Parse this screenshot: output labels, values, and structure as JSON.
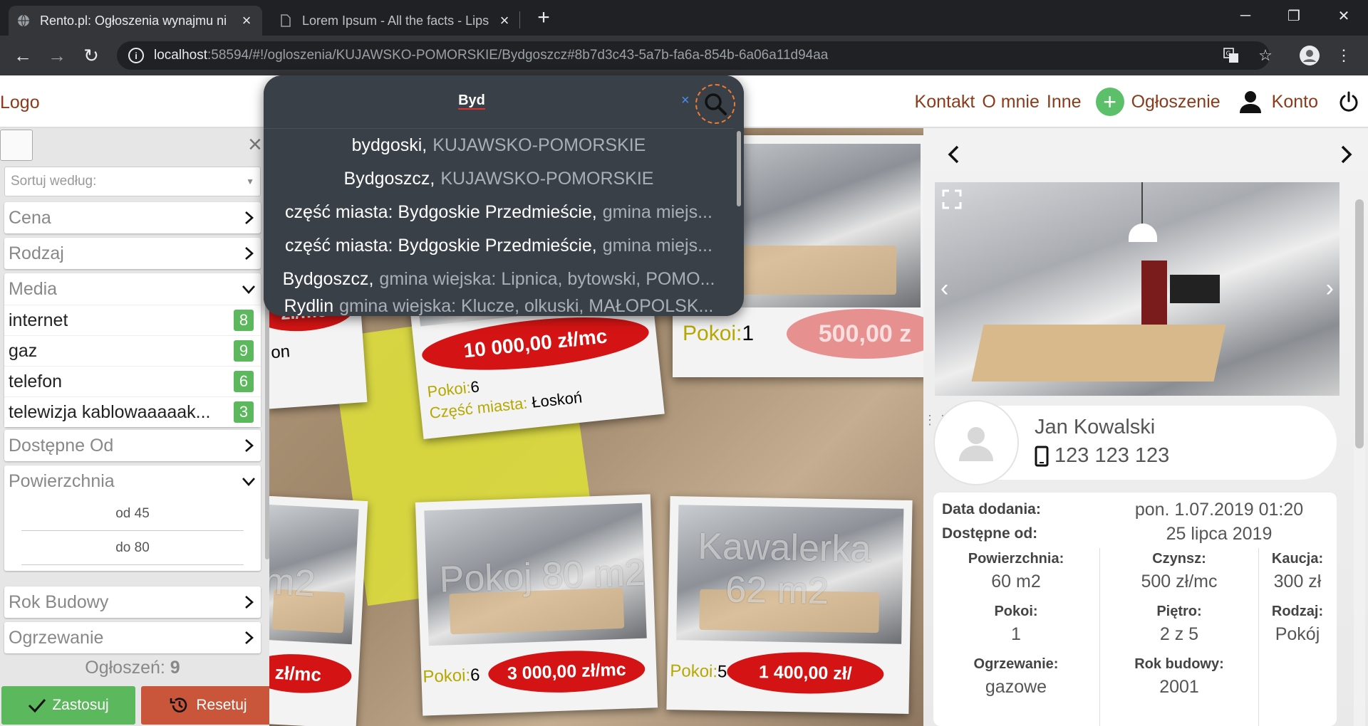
{
  "browser": {
    "tabs": [
      {
        "title": "Rento.pl: Ogłoszenia wynajmu ni",
        "active": true
      },
      {
        "title": "Lorem Ipsum - All the facts - Lips",
        "active": false
      }
    ],
    "url_host": "localhost",
    "url_rest": ":58594/#!/ogloszenia/KUJAWSKO-POMORSKIE/Bydgoszcz#8b7d3c43-5a7b-fa6a-854b-6a06a11d94aa"
  },
  "header": {
    "logo": "Logo",
    "nav": {
      "kontakt": "Kontakt",
      "omnie": "O mnie",
      "inne": "Inne",
      "ogloszenie": "Ogłoszenie",
      "konto": "Konto"
    }
  },
  "search": {
    "query": "Byd",
    "clear": "×",
    "suggestions": [
      {
        "main": "bydgoski,",
        "muted": "KUJAWSKO-POMORSKIE"
      },
      {
        "main": "Bydgoszcz,",
        "muted": "KUJAWSKO-POMORSKIE"
      },
      {
        "main": "część miasta: Bydgoskie Przedmieście,",
        "muted": "gmina miejs..."
      },
      {
        "main": "część miasta: Bydgoskie Przedmieście,",
        "muted": "gmina miejs..."
      },
      {
        "main": "Bydgoszcz,",
        "muted": "gmina wiejska: Lipnica, bytowski, POMO..."
      },
      {
        "main": "Rydlin",
        "muted": "gmina wiejska: Klucze, olkuski, MAŁOPOLSK..."
      }
    ]
  },
  "sidebar": {
    "sort_placeholder": "Sortuj według:",
    "filters": {
      "cena": "Cena",
      "rodzaj": "Rodzaj",
      "media": "Media",
      "dostepne": "Dostępne Od",
      "powierzchnia": "Powierzchnia",
      "rok": "Rok Budowy",
      "ogrzewanie": "Ogrzewanie"
    },
    "media_items": [
      {
        "label": "internet",
        "count": "8"
      },
      {
        "label": "gaz",
        "count": "9"
      },
      {
        "label": "telefon",
        "count": "6"
      },
      {
        "label": "telewizja kablowaaaaak...",
        "count": "3"
      }
    ],
    "area_from": "od 45",
    "area_to": "do 80",
    "count_label": "Ogłoszeń:",
    "count_value": "9",
    "apply": "Zastosuj",
    "reset": "Resetuj"
  },
  "listings": {
    "c1_price": "zł/mc",
    "c2_price": "10 000,00 zł/mc",
    "c2_rooms_label": "Pokoi:",
    "c2_rooms": "6",
    "c2_district_label": "Część miasta:",
    "c2_district": "Łoskoń",
    "c3_rooms_label": "Pokoi:",
    "c3_rooms": "1",
    "c3_price": "500,00 z",
    "c1_partial": "on",
    "c4_ghost": "m2",
    "c4_price": "zł/mc",
    "c5_ghost": "Pokoj 80 m2",
    "c5_rooms_label": "Pokoi:",
    "c5_rooms": "6",
    "c5_price": "3 000,00 zł/mc",
    "c6_ghost1": "Kawalerka",
    "c6_ghost2": "62 m2",
    "c6_rooms_label": "Pokoi:",
    "c6_rooms": "5",
    "c6_price": "1 400,00 zł/"
  },
  "detail": {
    "owner_name": "Jan Kowalski",
    "owner_phone": "123 123 123",
    "added_label": "Data dodania:",
    "added_value": "pon. 1.07.2019 01:20",
    "available_label": "Dostępne od:",
    "available_value": "25 lipca 2019",
    "grid": [
      {
        "label": "Powierzchnia:",
        "value": "60 m2"
      },
      {
        "label": "Czynsz:",
        "value": "500 zł/mc"
      },
      {
        "label": "Kaucja:",
        "value": "300 zł"
      },
      {
        "label": "Pokoi:",
        "value": "1"
      },
      {
        "label": "Piętro:",
        "value": "2 z 5"
      },
      {
        "label": "Rodzaj:",
        "value": "Pokój"
      },
      {
        "label": "Ogrzewanie:",
        "value": "gazowe"
      },
      {
        "label": "Rok budowy:",
        "value": "2001"
      }
    ]
  }
}
